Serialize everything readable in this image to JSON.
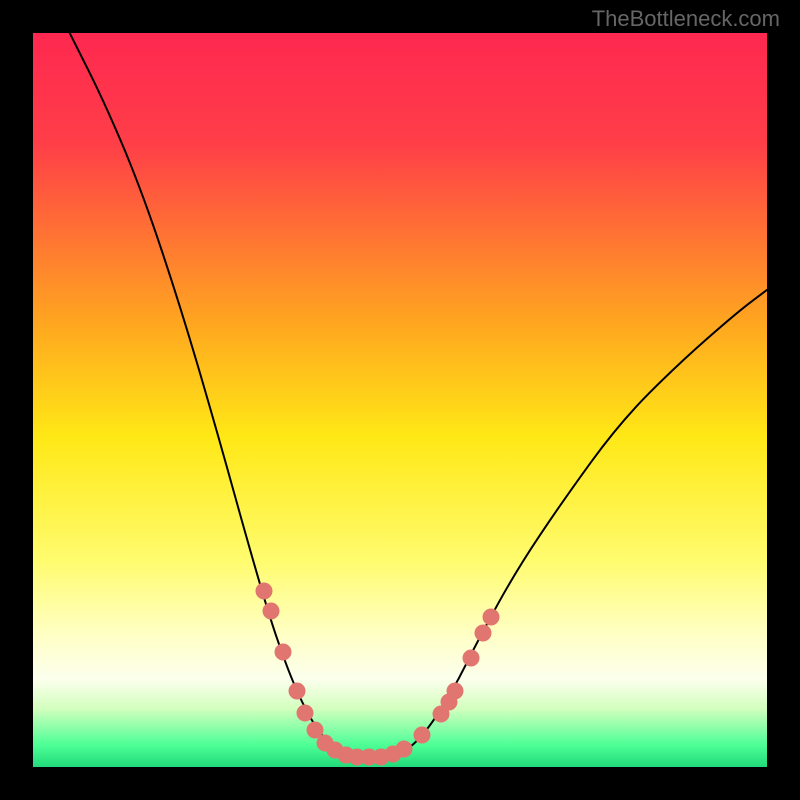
{
  "branding": {
    "watermark": "TheBottleneck.com"
  },
  "chart_data": {
    "type": "line",
    "title": "",
    "xlabel": "",
    "ylabel": "",
    "xlim": [
      0,
      100
    ],
    "ylim": [
      0,
      100
    ],
    "background_gradient": {
      "stops": [
        {
          "offset": 0.0,
          "color": "#ff2850"
        },
        {
          "offset": 0.15,
          "color": "#ff3e48"
        },
        {
          "offset": 0.4,
          "color": "#ffa81f"
        },
        {
          "offset": 0.55,
          "color": "#ffe816"
        },
        {
          "offset": 0.72,
          "color": "#fffc6f"
        },
        {
          "offset": 0.82,
          "color": "#ffffc5"
        },
        {
          "offset": 0.88,
          "color": "#fcffed"
        },
        {
          "offset": 0.92,
          "color": "#d4ffbf"
        },
        {
          "offset": 0.97,
          "color": "#4dff96"
        },
        {
          "offset": 1.0,
          "color": "#21da7a"
        }
      ]
    },
    "series": [
      {
        "name": "bottleneck-curve",
        "type": "curve",
        "color": "#000000",
        "path_xy": [
          [
            5,
            100
          ],
          [
            10,
            90
          ],
          [
            15,
            78
          ],
          [
            20,
            63
          ],
          [
            25,
            46
          ],
          [
            30,
            28
          ],
          [
            33,
            18
          ],
          [
            36,
            10
          ],
          [
            39,
            4.5
          ],
          [
            42,
            1.7
          ],
          [
            44,
            1.2
          ],
          [
            46,
            1.2
          ],
          [
            48,
            1.2
          ],
          [
            50,
            1.7
          ],
          [
            53,
            4
          ],
          [
            57,
            10
          ],
          [
            61,
            18
          ],
          [
            66,
            27
          ],
          [
            72,
            36
          ],
          [
            80,
            47
          ],
          [
            88,
            55
          ],
          [
            96,
            62
          ],
          [
            100,
            65
          ]
        ]
      },
      {
        "name": "highlight-points",
        "type": "scatter",
        "color": "#e1756f",
        "points_xy": [
          [
            31.5,
            24.0
          ],
          [
            32.4,
            21.3
          ],
          [
            34.1,
            15.7
          ],
          [
            35.9,
            10.3
          ],
          [
            37.1,
            7.3
          ],
          [
            38.4,
            5.1
          ],
          [
            39.8,
            3.3
          ],
          [
            41.2,
            2.3
          ],
          [
            42.6,
            1.7
          ],
          [
            44.2,
            1.4
          ],
          [
            45.8,
            1.3
          ],
          [
            47.4,
            1.4
          ],
          [
            49.0,
            1.8
          ],
          [
            50.6,
            2.5
          ],
          [
            53.0,
            4.3
          ],
          [
            55.6,
            7.2
          ],
          [
            56.7,
            8.8
          ],
          [
            57.5,
            10.4
          ],
          [
            59.7,
            14.8
          ],
          [
            61.3,
            18.3
          ],
          [
            62.4,
            20.4
          ]
        ]
      }
    ]
  }
}
